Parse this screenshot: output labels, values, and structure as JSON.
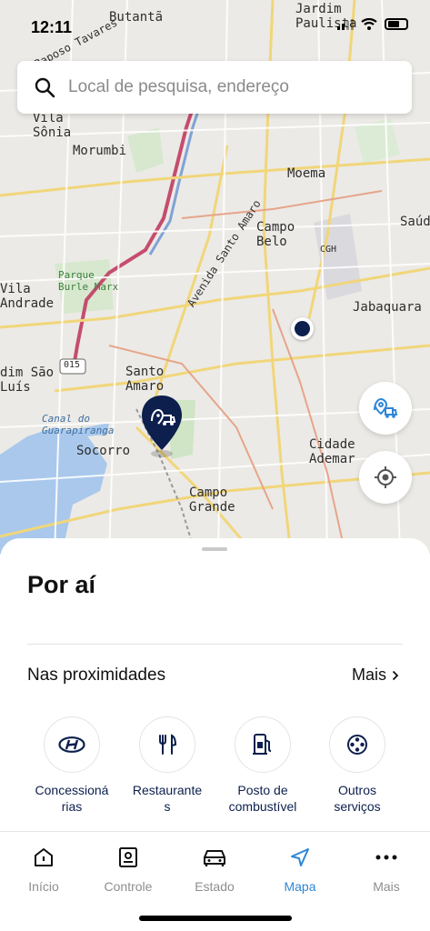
{
  "status": {
    "time": "12:11"
  },
  "search": {
    "placeholder": "Local de pesquisa, endereço"
  },
  "map": {
    "labels": {
      "butanta": "Butantã",
      "jardim_paulista": "Jardim\nPaulista",
      "raposo_tavares": "Raposo Tavares",
      "vila_sonia": "Vila\nSônia",
      "morumbi": "Morumbi",
      "moema": "Moema",
      "saude": "Saúd",
      "campo_belo": "Campo\nBelo",
      "cgh": "CGH",
      "parque_burle_marx": "Parque\nBurle Marx",
      "avenida_santo_amaro": "Avenida Santo Amaro",
      "vila_andrade": "Vila\nAndrade",
      "jabaquara": "Jabaquara",
      "road_015": "015",
      "jardim_sao_luis": "dim São\nLuís",
      "santo_amaro": "Santo\nAmaro",
      "canal_guarapiranga": "Canal do\nGuarapiranga",
      "socorro": "Socorro",
      "cidade_ademar": "Cidade\nAdemar",
      "campo_grande": "Campo\nGrande"
    }
  },
  "sheet": {
    "title": "Por aí",
    "nearby_label": "Nas proximidades",
    "more_label": "Mais",
    "categories": [
      {
        "label": "Concessioná\nrias",
        "icon": "hyundai-logo-icon"
      },
      {
        "label": "Restaurante\ns",
        "icon": "fork-knife-icon"
      },
      {
        "label": "Posto de\ncombustível",
        "icon": "fuel-pump-icon"
      },
      {
        "label": "Outros\nserviços",
        "icon": "film-reel-icon"
      }
    ]
  },
  "tabbar": {
    "tabs": [
      {
        "label": "Início",
        "icon": "home-icon",
        "active": false
      },
      {
        "label": "Controle",
        "icon": "remote-control-icon",
        "active": false
      },
      {
        "label": "Estado",
        "icon": "car-icon",
        "active": false
      },
      {
        "label": "Mapa",
        "icon": "navigation-arrow-icon",
        "active": true
      },
      {
        "label": "Mais",
        "icon": "more-dots-icon",
        "active": false
      }
    ]
  },
  "colors": {
    "accent": "#2f86d6",
    "navy": "#0c1f4d",
    "map_bg": "#eceae6",
    "water": "#a9c8ec"
  }
}
